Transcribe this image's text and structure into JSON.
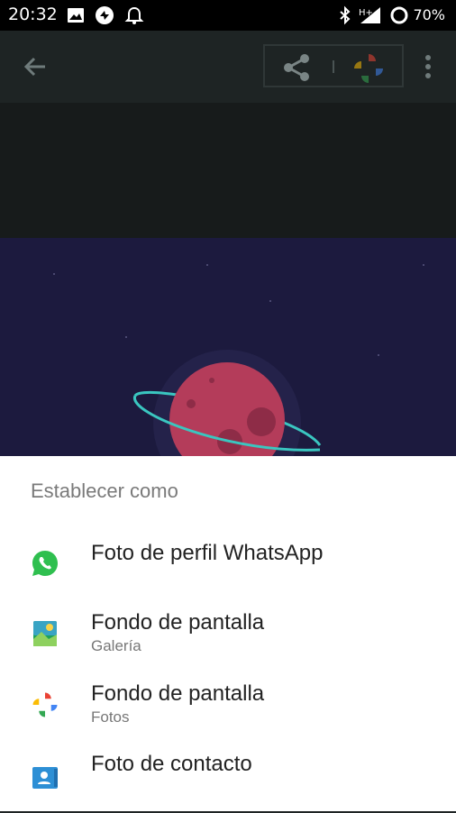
{
  "status_bar": {
    "time": "20:32",
    "battery": "70%",
    "icons": [
      "image-icon",
      "sync-icon",
      "bell-icon",
      "bluetooth-icon",
      "signal-h-plus-icon",
      "battery-ring-icon"
    ]
  },
  "app_bar": {
    "back_icon": "arrow-back-icon",
    "share_icon": "share-icon",
    "photos_icon": "google-photos-icon",
    "more_icon": "more-vert-icon"
  },
  "sheet": {
    "title": "Establecer como",
    "options": [
      {
        "label": "Foto de perfil WhatsApp",
        "sublabel": "",
        "icon": "whatsapp-icon"
      },
      {
        "label": "Fondo de pantalla",
        "sublabel": "Galería",
        "icon": "gallery-icon"
      },
      {
        "label": "Fondo de pantalla",
        "sublabel": "Fotos",
        "icon": "google-photos-icon"
      },
      {
        "label": "Foto de contacto",
        "sublabel": "",
        "icon": "contacts-icon"
      }
    ]
  },
  "colors": {
    "app_bar": "#1e2424",
    "space": "#1c1a3e",
    "planet": "#b43c5a",
    "ring": "#3ac6c0",
    "whatsapp": "#2fbf4f"
  }
}
